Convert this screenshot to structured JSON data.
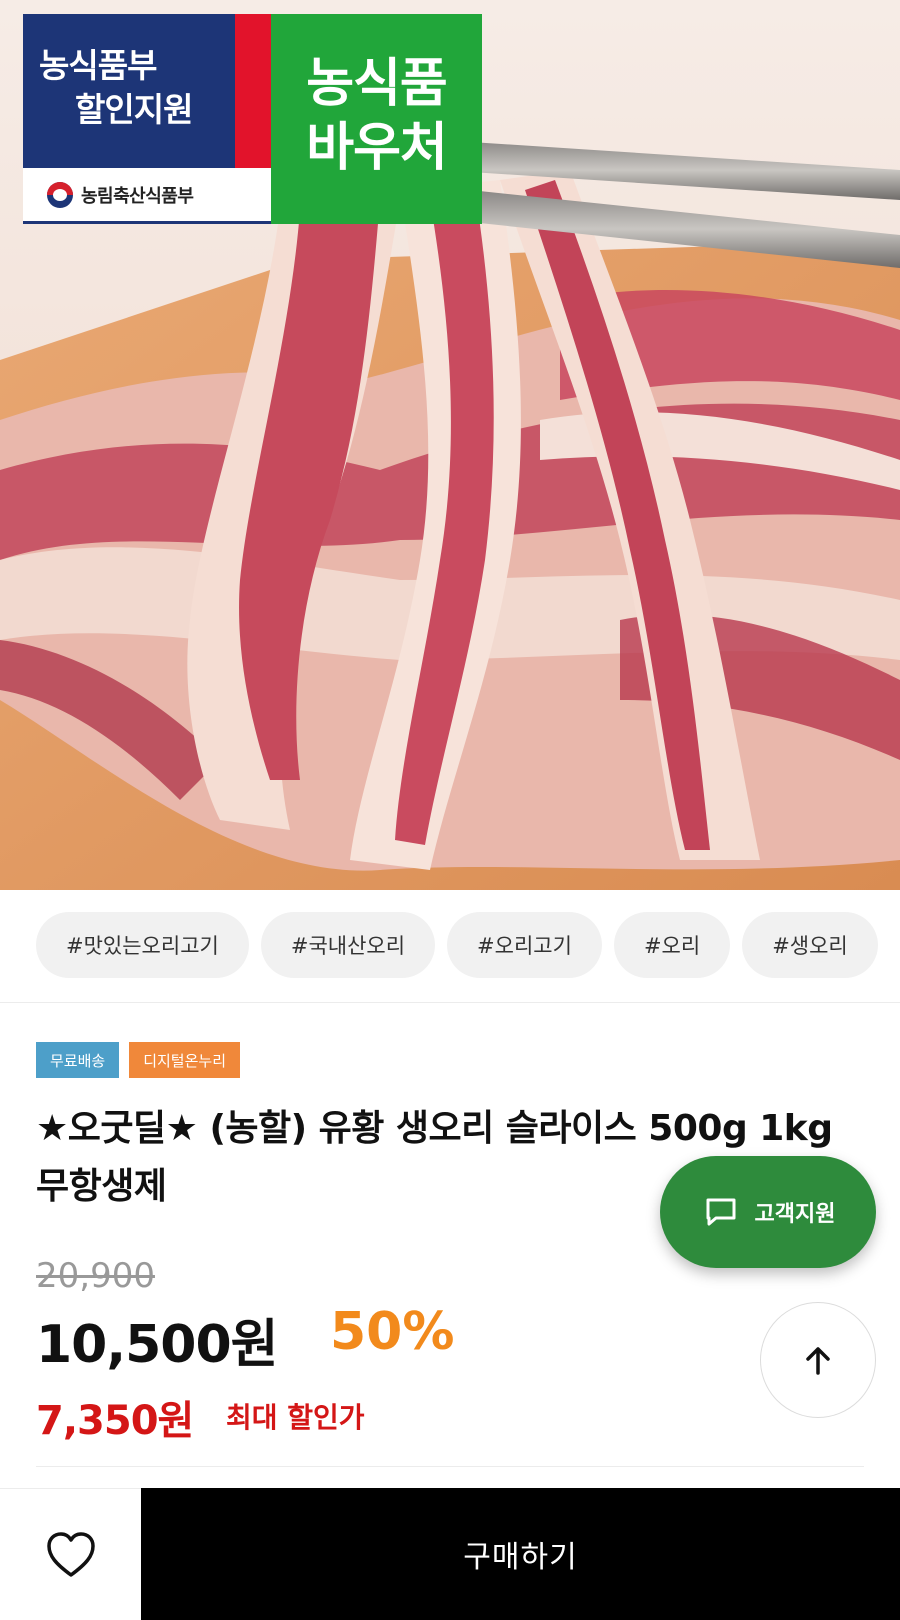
{
  "hero": {
    "gov_badge_line1": "농식품부",
    "gov_badge_line2": "할인지원",
    "ministry": "농림축산식품부",
    "voucher_line1": "농식품",
    "voucher_line2": "바우처"
  },
  "tags": [
    "#맛있는오리고기",
    "#국내산오리",
    "#오리고기",
    "#오리",
    "#생오리"
  ],
  "product": {
    "chip_free_shipping": "무료배송",
    "chip_onnuri": "디지털온누리",
    "title": "★오굿딜★ (농할) 유황 생오리 슬라이스 500g 1kg 무항생제",
    "original_price": "20,900",
    "sale_price": "10,500원",
    "discount_rate": "50%",
    "max_discount_price": "7,350원",
    "max_discount_label": "최대 할인가"
  },
  "floating": {
    "support_label": "고객지원"
  },
  "bottom_bar": {
    "buy_label": "구매하기"
  },
  "colors": {
    "gov_navy": "#1d3577",
    "voucher_green": "#21a63a",
    "support_green": "#2e8b3c",
    "discount_orange": "#f28a1c",
    "max_price_red": "#d41616",
    "chip_blue": "#4d9fc9",
    "chip_orange": "#f0883a"
  }
}
